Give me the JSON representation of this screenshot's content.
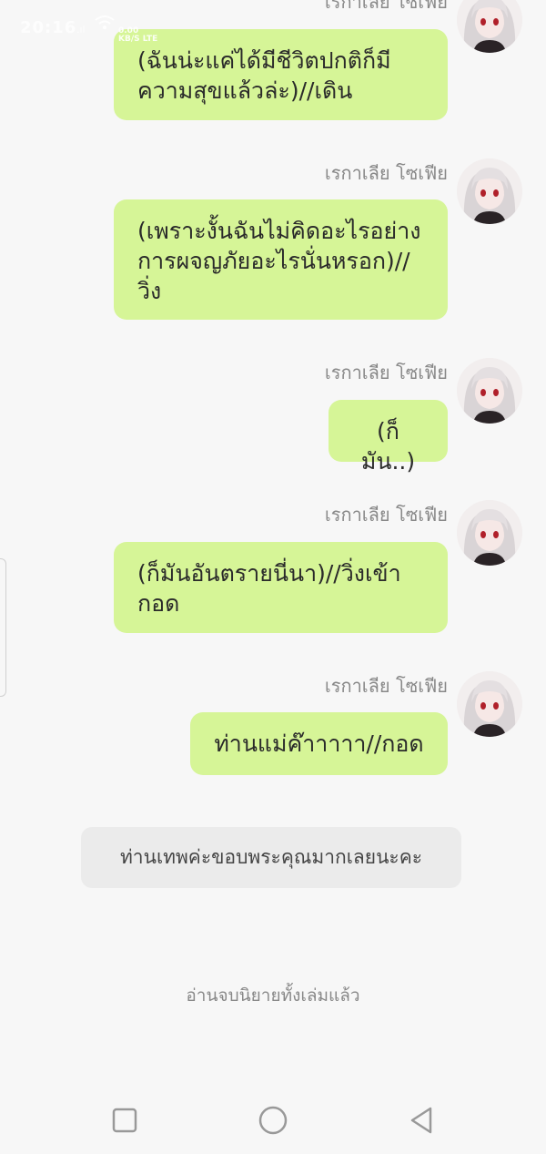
{
  "status_bar": {
    "time": "20:16",
    "signal": ".ıl",
    "network_speed": "0.00",
    "network_unit": "KB/S",
    "network_type": "LTE"
  },
  "messages": [
    {
      "sender": "เรกาเลีย โซเฟีย",
      "text": "(ฉันน่ะแค่ได้มีชีวิตปกติก็มีความสุขแล้วล่ะ)//เดิน"
    },
    {
      "sender": "เรกาเลีย โซเฟีย",
      "text": "(เพราะงั้นฉันไม่คิดอะไรอย่างการผจญภัยอะไรนั่นหรอก)//วิ่ง"
    },
    {
      "sender": "เรกาเลีย โซเฟีย",
      "text": "(ก็มัน..)"
    },
    {
      "sender": "เรกาเลีย โซเฟีย",
      "text": "(ก็มันอันตรายนี่นา)//วิ่งเข้ากอด"
    },
    {
      "sender": "เรกาเลีย โซเฟีย",
      "text": "ท่านแม่ค๊าาาาา//กอด"
    }
  ],
  "system_message": "ท่านเทพค่ะขอบพระคุณมากเลยนะคะ",
  "end_note": "อ่านจบนิยายทั้งเล่มแล้ว",
  "nav": {
    "recents": "square-icon",
    "home": "circle-icon",
    "back": "triangle-back-icon"
  },
  "colors": {
    "bubble": "#d6f597",
    "background": "#f7f7f7",
    "system_bubble": "#ebebeb"
  }
}
